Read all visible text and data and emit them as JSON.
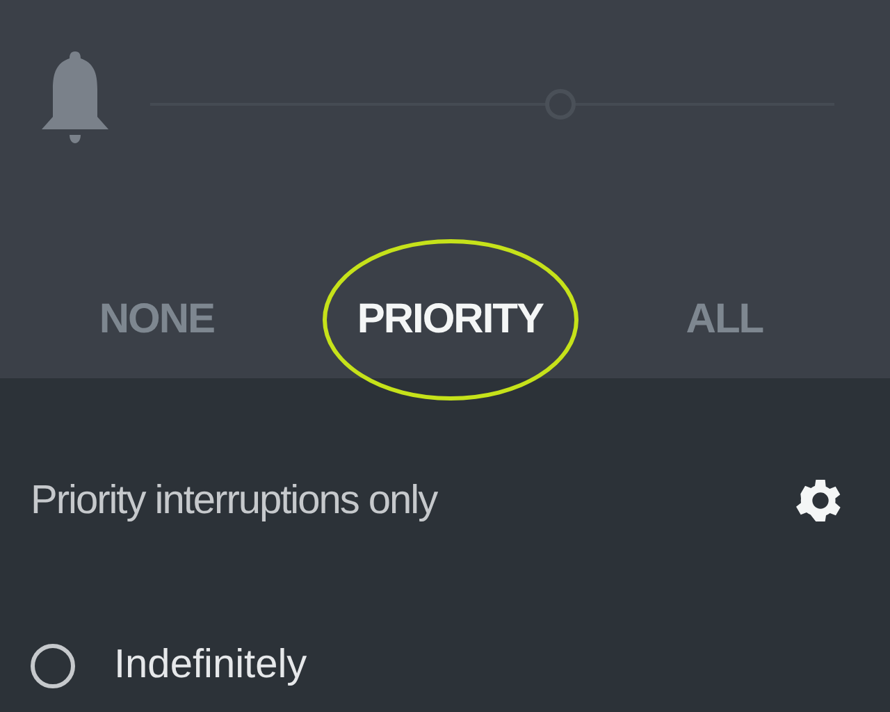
{
  "volume": {
    "level": 0.6
  },
  "modes": [
    {
      "label": "NONE",
      "selected": false
    },
    {
      "label": "PRIORITY",
      "selected": true
    },
    {
      "label": "ALL",
      "selected": false
    }
  ],
  "summary": {
    "text": "Priority interruptions only"
  },
  "durations": [
    {
      "label": "Indefinitely",
      "selected": false
    }
  ]
}
